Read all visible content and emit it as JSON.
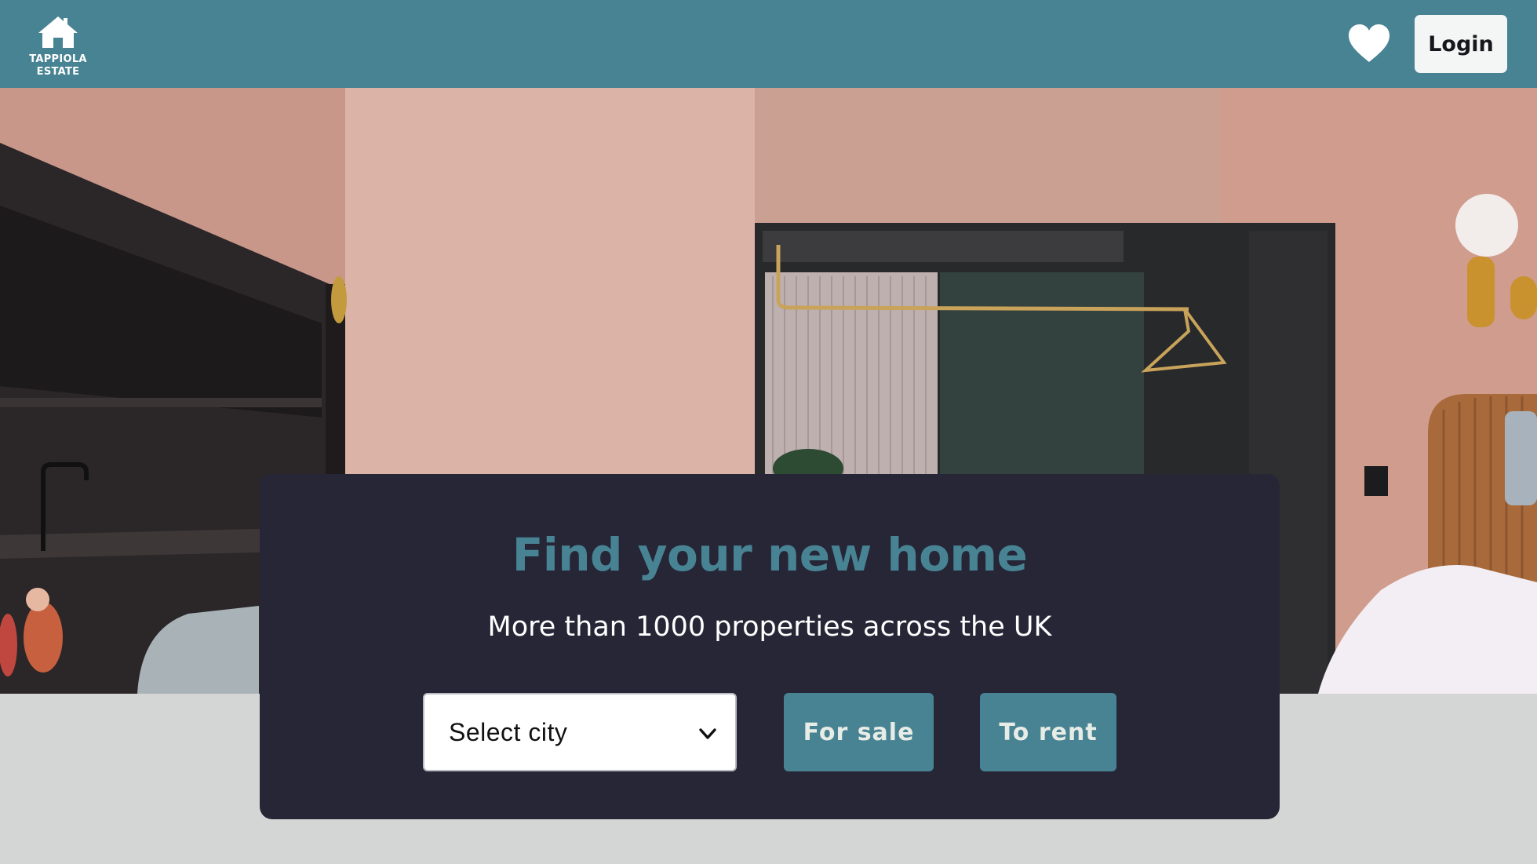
{
  "header": {
    "logo_text": "TAPPIOLA ESTATE",
    "logo_icon": "house-icon",
    "favorites_icon": "heart-icon",
    "login_label": "Login"
  },
  "hero": {
    "image": "room-interior-photo"
  },
  "search": {
    "title": "Find your new home",
    "subtitle": "More than 1000 properties across the UK",
    "city_select_value": "Select city",
    "city_select_icon": "chevron-down-icon",
    "for_sale_label": "For sale",
    "to_rent_label": "To rent"
  },
  "colors": {
    "brand": "#488393",
    "panel_background": "#262637",
    "page_background": "#D4D6D6"
  }
}
